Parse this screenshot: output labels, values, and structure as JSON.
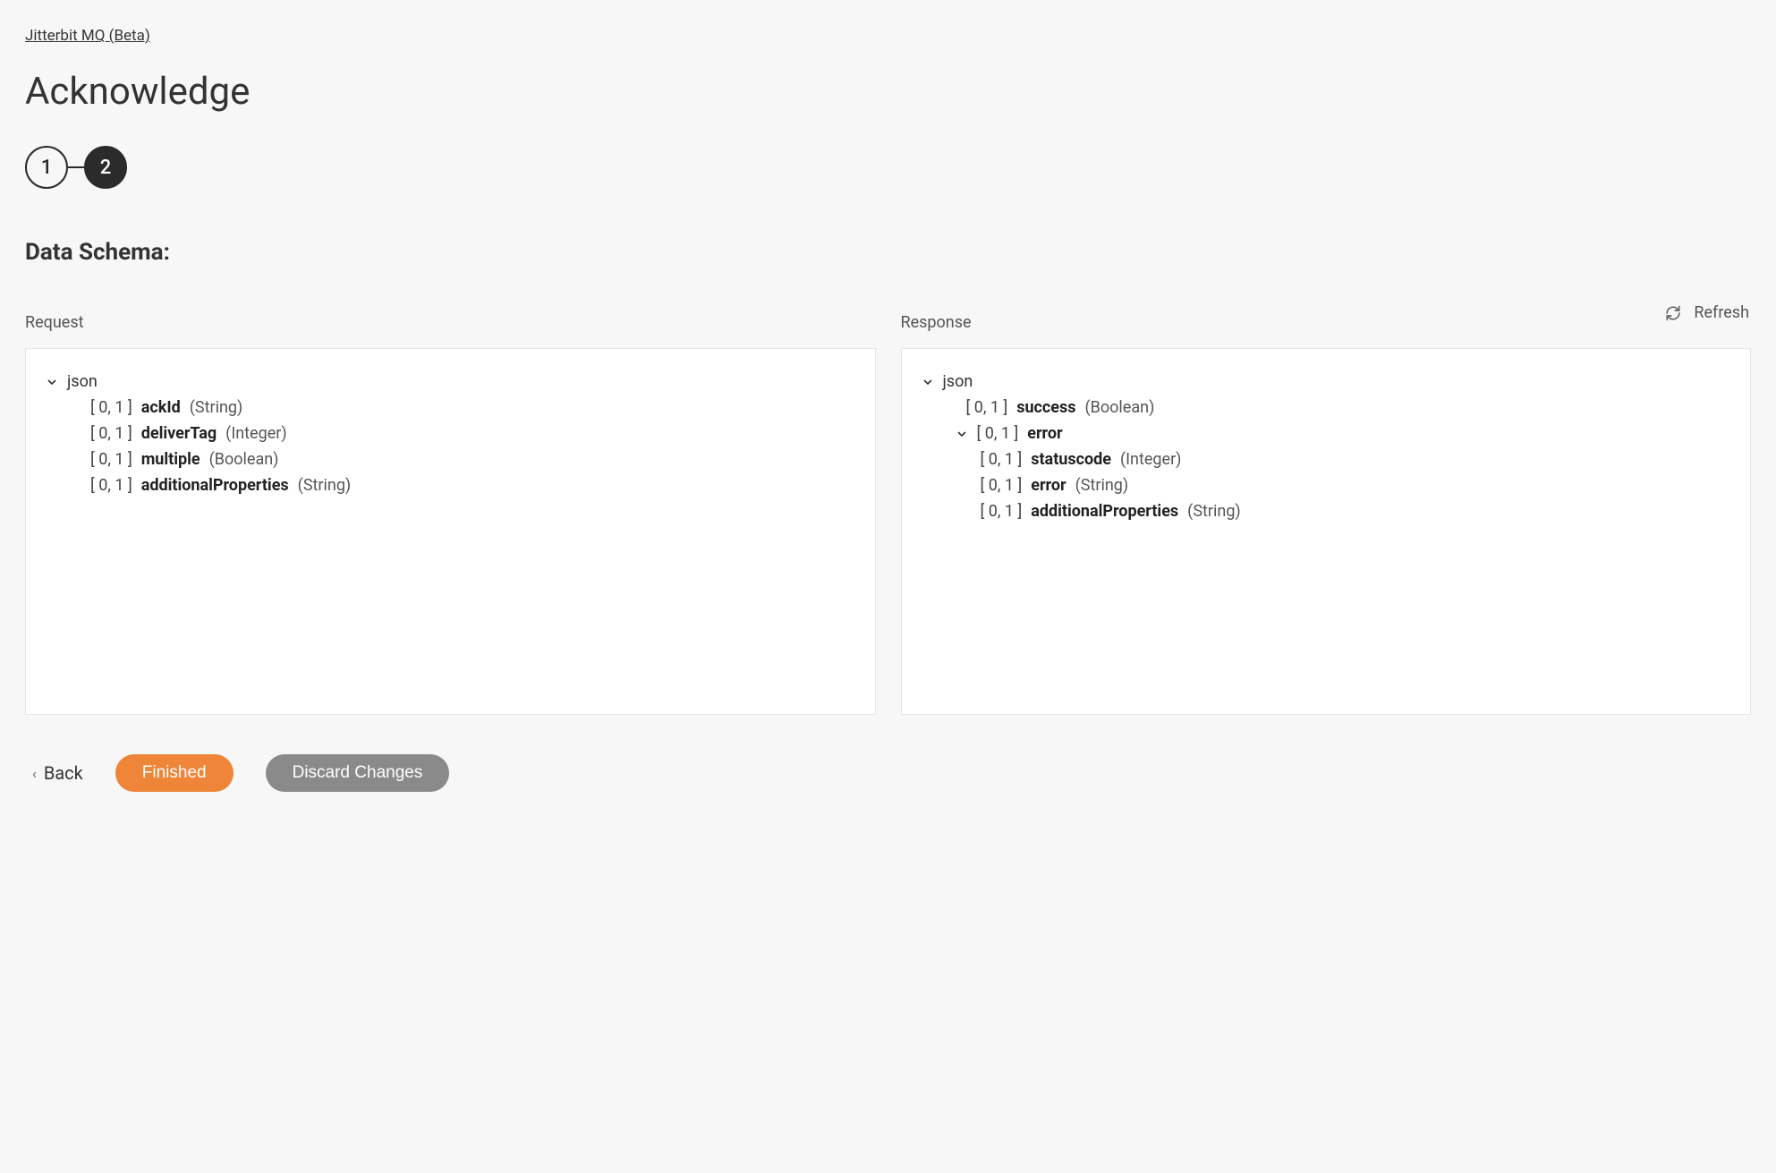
{
  "breadcrumb": "Jitterbit MQ (Beta)",
  "title": "Acknowledge",
  "stepper": {
    "step1": "1",
    "step2": "2"
  },
  "section_title": "Data Schema:",
  "refresh_label": "Refresh",
  "request": {
    "label": "Request",
    "root": "json",
    "fields": [
      {
        "card": "[ 0, 1 ]",
        "name": "ackId",
        "type": "(String)"
      },
      {
        "card": "[ 0, 1 ]",
        "name": "deliverTag",
        "type": "(Integer)"
      },
      {
        "card": "[ 0, 1 ]",
        "name": "multiple",
        "type": "(Boolean)"
      },
      {
        "card": "[ 0, 1 ]",
        "name": "additionalProperties",
        "type": "(String)"
      }
    ]
  },
  "response": {
    "label": "Response",
    "root": "json",
    "success": {
      "card": "[ 0, 1 ]",
      "name": "success",
      "type": "(Boolean)"
    },
    "error_group": {
      "card": "[ 0, 1 ]",
      "name": "error"
    },
    "error_fields": [
      {
        "card": "[ 0, 1 ]",
        "name": "statuscode",
        "type": "(Integer)"
      },
      {
        "card": "[ 0, 1 ]",
        "name": "error",
        "type": "(String)"
      },
      {
        "card": "[ 0, 1 ]",
        "name": "additionalProperties",
        "type": "(String)"
      }
    ]
  },
  "footer": {
    "back": "Back",
    "finished": "Finished",
    "discard": "Discard Changes"
  }
}
